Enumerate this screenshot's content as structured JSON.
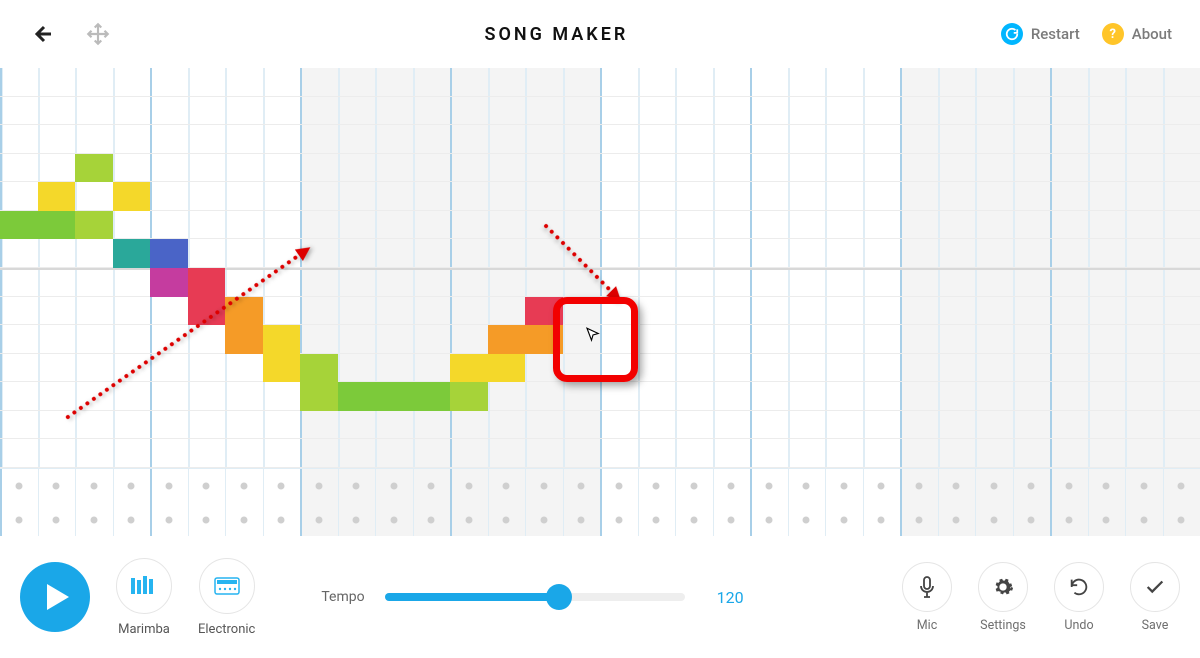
{
  "header": {
    "title": "SONG MAKER",
    "restart_label": "Restart",
    "about_label": "About"
  },
  "grid": {
    "beats": 32,
    "beats_per_bar": 4,
    "rows": 14,
    "perc_rows": 2,
    "shaded_bars": [
      2,
      3,
      6,
      7
    ],
    "notes": [
      {
        "col": 0,
        "row": 8,
        "color": "green"
      },
      {
        "col": 1,
        "row": 8,
        "color": "green"
      },
      {
        "col": 2,
        "row": 8,
        "color": "lime"
      },
      {
        "col": 1,
        "row": 9,
        "color": "yellow"
      },
      {
        "col": 2,
        "row": 10,
        "color": "lime"
      },
      {
        "col": 3,
        "row": 9,
        "color": "yellow"
      },
      {
        "col": 3,
        "row": 7,
        "color": "teal"
      },
      {
        "col": 4,
        "row": 7,
        "color": "blue"
      },
      {
        "col": 4,
        "row": 6,
        "color": "magenta"
      },
      {
        "col": 5,
        "row": 6,
        "color": "red"
      },
      {
        "col": 5,
        "row": 5,
        "color": "red"
      },
      {
        "col": 6,
        "row": 5,
        "color": "orange"
      },
      {
        "col": 6,
        "row": 4,
        "color": "orange"
      },
      {
        "col": 7,
        "row": 4,
        "color": "yellow"
      },
      {
        "col": 7,
        "row": 3,
        "color": "yellow"
      },
      {
        "col": 8,
        "row": 3,
        "color": "lime"
      },
      {
        "col": 8,
        "row": 2,
        "color": "lime"
      },
      {
        "col": 9,
        "row": 2,
        "color": "green"
      },
      {
        "col": 10,
        "row": 2,
        "color": "green"
      },
      {
        "col": 11,
        "row": 2,
        "color": "green"
      },
      {
        "col": 12,
        "row": 3,
        "color": "yellow"
      },
      {
        "col": 12,
        "row": 2,
        "color": "lime"
      },
      {
        "col": 13,
        "row": 4,
        "color": "orange"
      },
      {
        "col": 13,
        "row": 3,
        "color": "yellow"
      },
      {
        "col": 14,
        "row": 5,
        "color": "red"
      },
      {
        "col": 14,
        "row": 4,
        "color": "orange"
      }
    ]
  },
  "footer": {
    "instrument1": "Marimba",
    "instrument2": "Electronic",
    "tempo_label": "Tempo",
    "tempo_value": "120",
    "mic_label": "Mic",
    "settings_label": "Settings",
    "undo_label": "Undo",
    "save_label": "Save"
  },
  "colors": {
    "accent": "#1aa7e8",
    "restart_badge": "#00b6ff",
    "about_badge": "#ffc529",
    "highlight_box": "#f20000"
  }
}
